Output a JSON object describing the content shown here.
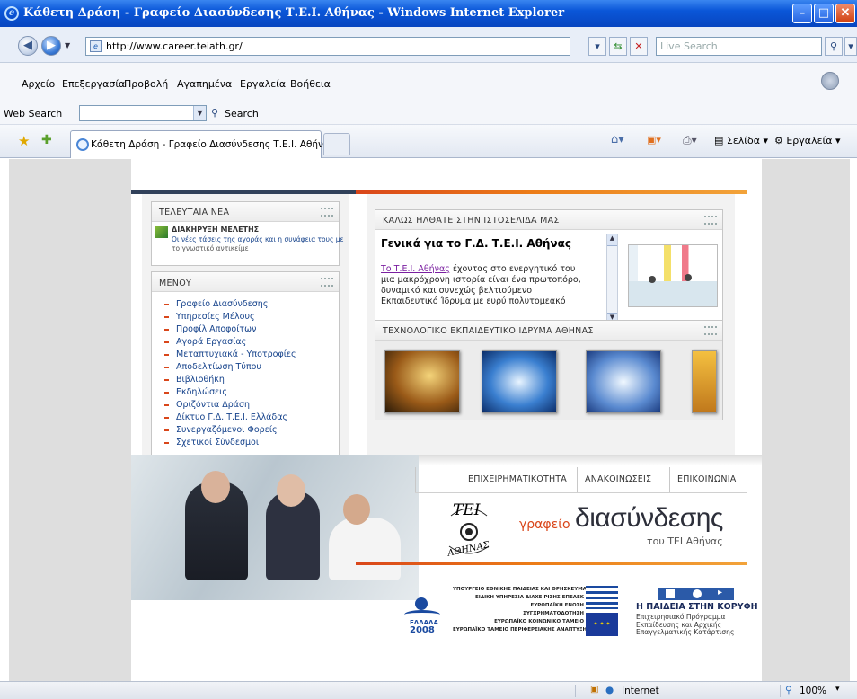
{
  "window": {
    "title": "Κάθετη Δράση - Γραφείο Διασύνδεσης Τ.Ε.Ι. Αθήνας - Windows Internet Explorer",
    "minimize": "–",
    "maximize": "□",
    "close": "✕"
  },
  "address_bar": {
    "url": "http://www.career.teiath.gr/",
    "search_placeholder": "Live Search"
  },
  "menu": [
    "Αρχείο",
    "Επεξεργασία",
    "Προβολή",
    "Αγαπημένα",
    "Εργαλεία",
    "Βοήθεια"
  ],
  "web_search": {
    "label": "Web Search",
    "button": "Search"
  },
  "tabs": {
    "active_title": "Κάθετη Δράση - Γραφείο Διασύνδεσης Τ.Ε.Ι. Αθήνας"
  },
  "command_bar": {
    "page": "Σελίδα",
    "tools": "Εργαλεία"
  },
  "page": {
    "news": {
      "title": "ΤΕΛΕΥΤΑΙΑ ΝΕΑ",
      "item_title": "ΔΙΑΚΗΡΥΞΗ ΜΕΛΕΤΗΣ",
      "item_text_1": "Οι νέες τάσεις της αγοράς και η συνάφεια τους με",
      "item_text_2": "το γνωστικό αντικείμε"
    },
    "menu": {
      "title": "ΜΕΝΟΥ",
      "items": [
        "Γραφείο Διασύνδεσης",
        "Υπηρεσίες Μέλους",
        "Προφίλ Αποφοίτων",
        "Αγορά Εργασίας",
        "Μεταπτυχιακά - Υποτροφίες",
        "Αποδελτίωση Τύπου",
        "Βιβλιοθήκη",
        "Εκδηλώσεις",
        "Οριζόντια Δράση",
        "Δίκτυο Γ.Δ. Τ.Ε.Ι. Ελλάδας",
        "Συνεργαζόμενοι Φορείς",
        "Σχετικοί Σύνδεσμοι"
      ]
    },
    "welcome": {
      "title": "ΚΑΛΩΣ ΗΛΘΑΤΕ ΣΤΗΝ ΙΣΤΟΣΕΛΙΔΑ ΜΑΣ",
      "heading": "Γενικά για το Γ.Δ. Τ.Ε.Ι. Αθήνας",
      "link": "Το Τ.Ε.Ι. Αθήνας",
      "text_1": " έχοντας στο ενεργητικό του",
      "text_2": "μια μακρόχρονη ιστορία είναι ένα πρωτοπόρο,",
      "text_3": "δυναμικό και συνεχώς βελτιούμενο",
      "text_4": "Εκπαιδευτικό Ίδρυμα με ευρύ πολυτομεακό"
    },
    "gallery": {
      "title": "ΤΕΧΝΟΛΟΓΙΚΟ ΕΚΠΑΙΔΕΥΤΙΚΟ ΙΔΡΥΜΑ ΑΘΗΝΑΣ"
    },
    "nav": [
      "ΕΠΙΧΕΙΡΗΜΑΤΙΚΟΤΗΤΑ",
      "ΑΝΑΚΟΙΝΩΣΕΙΣ",
      "ΕΠΙΚΟΙΝΩΝΙΑ"
    ],
    "brand": {
      "seal_top": "ΤΕΙ",
      "seal_bottom": "ΑΘΗΝΑΣ",
      "word_small": "γραφείο",
      "word_big": "διασύνδεσης",
      "sub": "του ΤΕΙ Αθήνας"
    },
    "footer": {
      "ellada_2008": "ΕΛΛΑΔΑ",
      "year": "2008",
      "ministry_1": "ΥΠΟΥΡΓΕΙΟ ΕΘΝΙΚΗΣ ΠΑΙΔΕΙΑΣ ΚΑΙ ΘΡΗΣΚΕΥΜΑΤΩΝ",
      "ministry_2": "ΕΙΔΙΚΗ ΥΠΗΡΕΣΙΑ ΔΙΑΧΕΙΡΙΣΗΣ ΕΠΕΑΕΚ",
      "ministry_3": "ΕΥΡΩΠΑΪΚΗ ΕΝΩΣΗ",
      "ministry_4": "ΣΥΓΧΡΗΜΑΤΟΔΟΤΗΣΗ",
      "ministry_5": "ΕΥΡΩΠΑΪΚΟ ΚΟΙΝΩΝΙΚΟ ΤΑΜΕΙΟ",
      "ministry_6": "ΕΥΡΩΠΑΪΚΟ ΤΑΜΕΙΟ ΠΕΡΙΦΕΡΕΙΑΚΗΣ ΑΝΑΠΤΥΞΗΣ",
      "paideia_title": "Η ΠΑΙΔΕΙΑ ΣΤΗΝ ΚΟΡΥΦΗ",
      "paideia_1": "Επιχειρησιακό Πρόγραμμα",
      "paideia_2": "Εκπαίδευσης και Αρχικής",
      "paideia_3": "Επαγγελματικής Κατάρτισης"
    }
  },
  "status_bar": {
    "zone": "Internet",
    "zoom": "100%"
  },
  "colors": {
    "titlebar": "#0a56d8",
    "accent_orange": "#d9461a",
    "link_blue": "#15428b",
    "rule_dark": "#31415a"
  }
}
